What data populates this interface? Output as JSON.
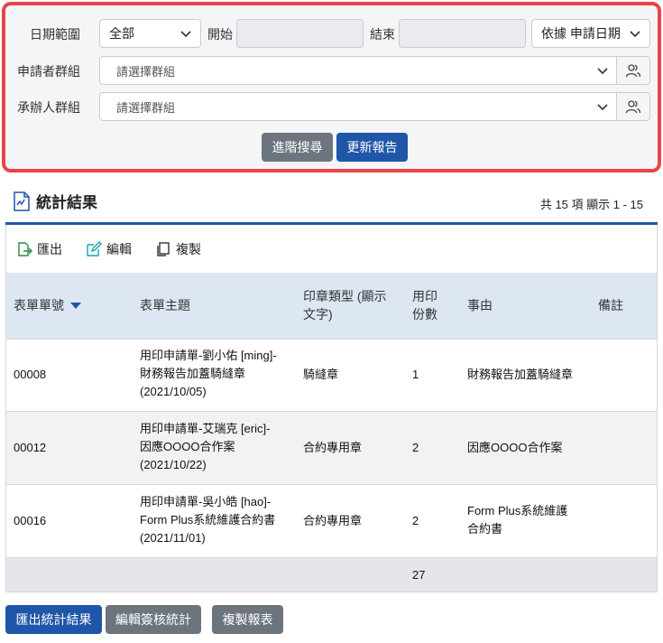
{
  "filters": {
    "date_range_label": "日期範圍",
    "date_range_value": "全部",
    "start_label": "開始",
    "start_value": "",
    "end_label": "結束",
    "end_value": "",
    "sort_by_value": "依據 申請日期",
    "applicant_group_label": "申請者群組",
    "applicant_group_placeholder": "請選擇群組",
    "handler_group_label": "承辦人群組",
    "handler_group_placeholder": "請選擇群組",
    "advanced_search_label": "進階搜尋",
    "update_report_label": "更新報告"
  },
  "results": {
    "title": "統計結果",
    "count_text": "共 15 項 顯示 1 - 15",
    "toolbar": {
      "export": "匯出",
      "edit": "編輯",
      "copy": "複製"
    },
    "columns": {
      "form_no": "表單單號",
      "subject": "表單主題",
      "seal_type_1": "印章類型 (顯示",
      "seal_type_2": "文字)",
      "print_count_1": "用印",
      "print_count_2": "份數",
      "reason": "事由",
      "note": "備註"
    },
    "rows": [
      {
        "form_no": "00008",
        "subject_1": "用印申請單-劉小佑 [ming]-",
        "subject_2": "財務報告加蓋騎縫章",
        "subject_3": "(2021/10/05)",
        "seal_type": "騎縫章",
        "count": "1",
        "reason_1": "財務報告加蓋騎縫章",
        "reason_2": ""
      },
      {
        "form_no": "00012",
        "subject_1": "用印申請單-艾瑞克 [eric]-",
        "subject_2": "因應OOOO合作案",
        "subject_3": "(2021/10/22)",
        "seal_type": "合約專用章",
        "count": "2",
        "reason_1": "因應OOOO合作案",
        "reason_2": ""
      },
      {
        "form_no": "00016",
        "subject_1": "用印申請單-吳小皓 [hao]-",
        "subject_2": "Form Plus系統維護合約書",
        "subject_3": "(2021/11/01)",
        "seal_type": "合約專用章",
        "count": "2",
        "reason_1": "Form Plus系統維護",
        "reason_2": "合約書"
      }
    ],
    "total": "27"
  },
  "bottom_buttons": {
    "export_results": "匯出統計結果",
    "edit_stats": "編輯簽核統計",
    "copy_report": "複製報表"
  },
  "colors": {
    "accent": "#1f56a8",
    "highlight_border": "#e8454a",
    "gray_button": "#6c757d"
  }
}
